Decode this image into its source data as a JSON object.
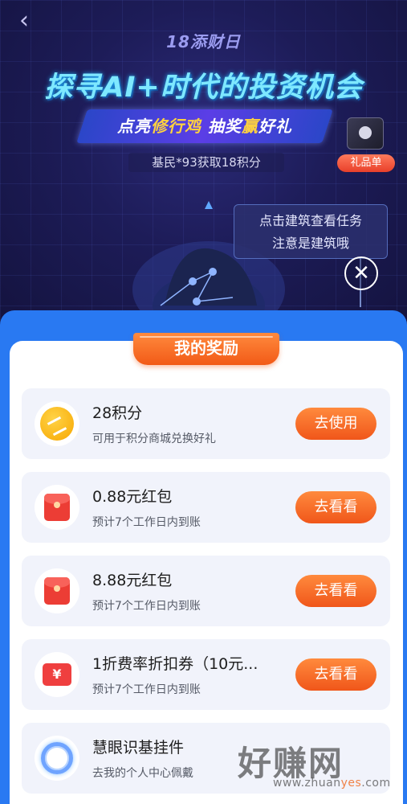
{
  "banner": {
    "back_icon": "chevron-left-icon",
    "event_tag": "18添财日",
    "title": "探寻AI+时代的投资机会",
    "subtitle_parts": [
      "点亮",
      "修行鸡",
      " 抽奖",
      "赢",
      "好礼"
    ],
    "ticker": "基民*93获取18积分",
    "gift_label": "礼品单",
    "tooltip_line1": "点击建筑查看任务",
    "tooltip_line2": "注意是建筑哦",
    "close_icon": "close-icon"
  },
  "rewards_panel": {
    "header": "我的奖励",
    "items": [
      {
        "icon": "points-coin-icon",
        "title": "28积分",
        "desc": "可用于积分商城兑换好礼",
        "button": "去使用"
      },
      {
        "icon": "red-envelope-icon",
        "title": "0.88元红包",
        "desc": "预计7个工作日内到账",
        "button": "去看看"
      },
      {
        "icon": "red-envelope-icon",
        "title": "8.88元红包",
        "desc": "预计7个工作日内到账",
        "button": "去看看"
      },
      {
        "icon": "coupon-icon",
        "title": "1折费率折扣券（10元...",
        "desc": "预计7个工作日内到账",
        "button": "去看看"
      },
      {
        "icon": "avatar-frame-icon",
        "title": "慧眼识基挂件",
        "desc": "去我的个人中心佩戴",
        "button": ""
      }
    ]
  },
  "watermark": {
    "text": "好赚网",
    "url_prefix": "www.zhuan",
    "url_accent": "yes",
    "url_suffix": ".com"
  },
  "colors": {
    "banner_bg": "#1d1c58",
    "sheet_blue": "#2979f2",
    "accent_orange": "#f25a17",
    "card_bg": "#f1f3fb"
  }
}
